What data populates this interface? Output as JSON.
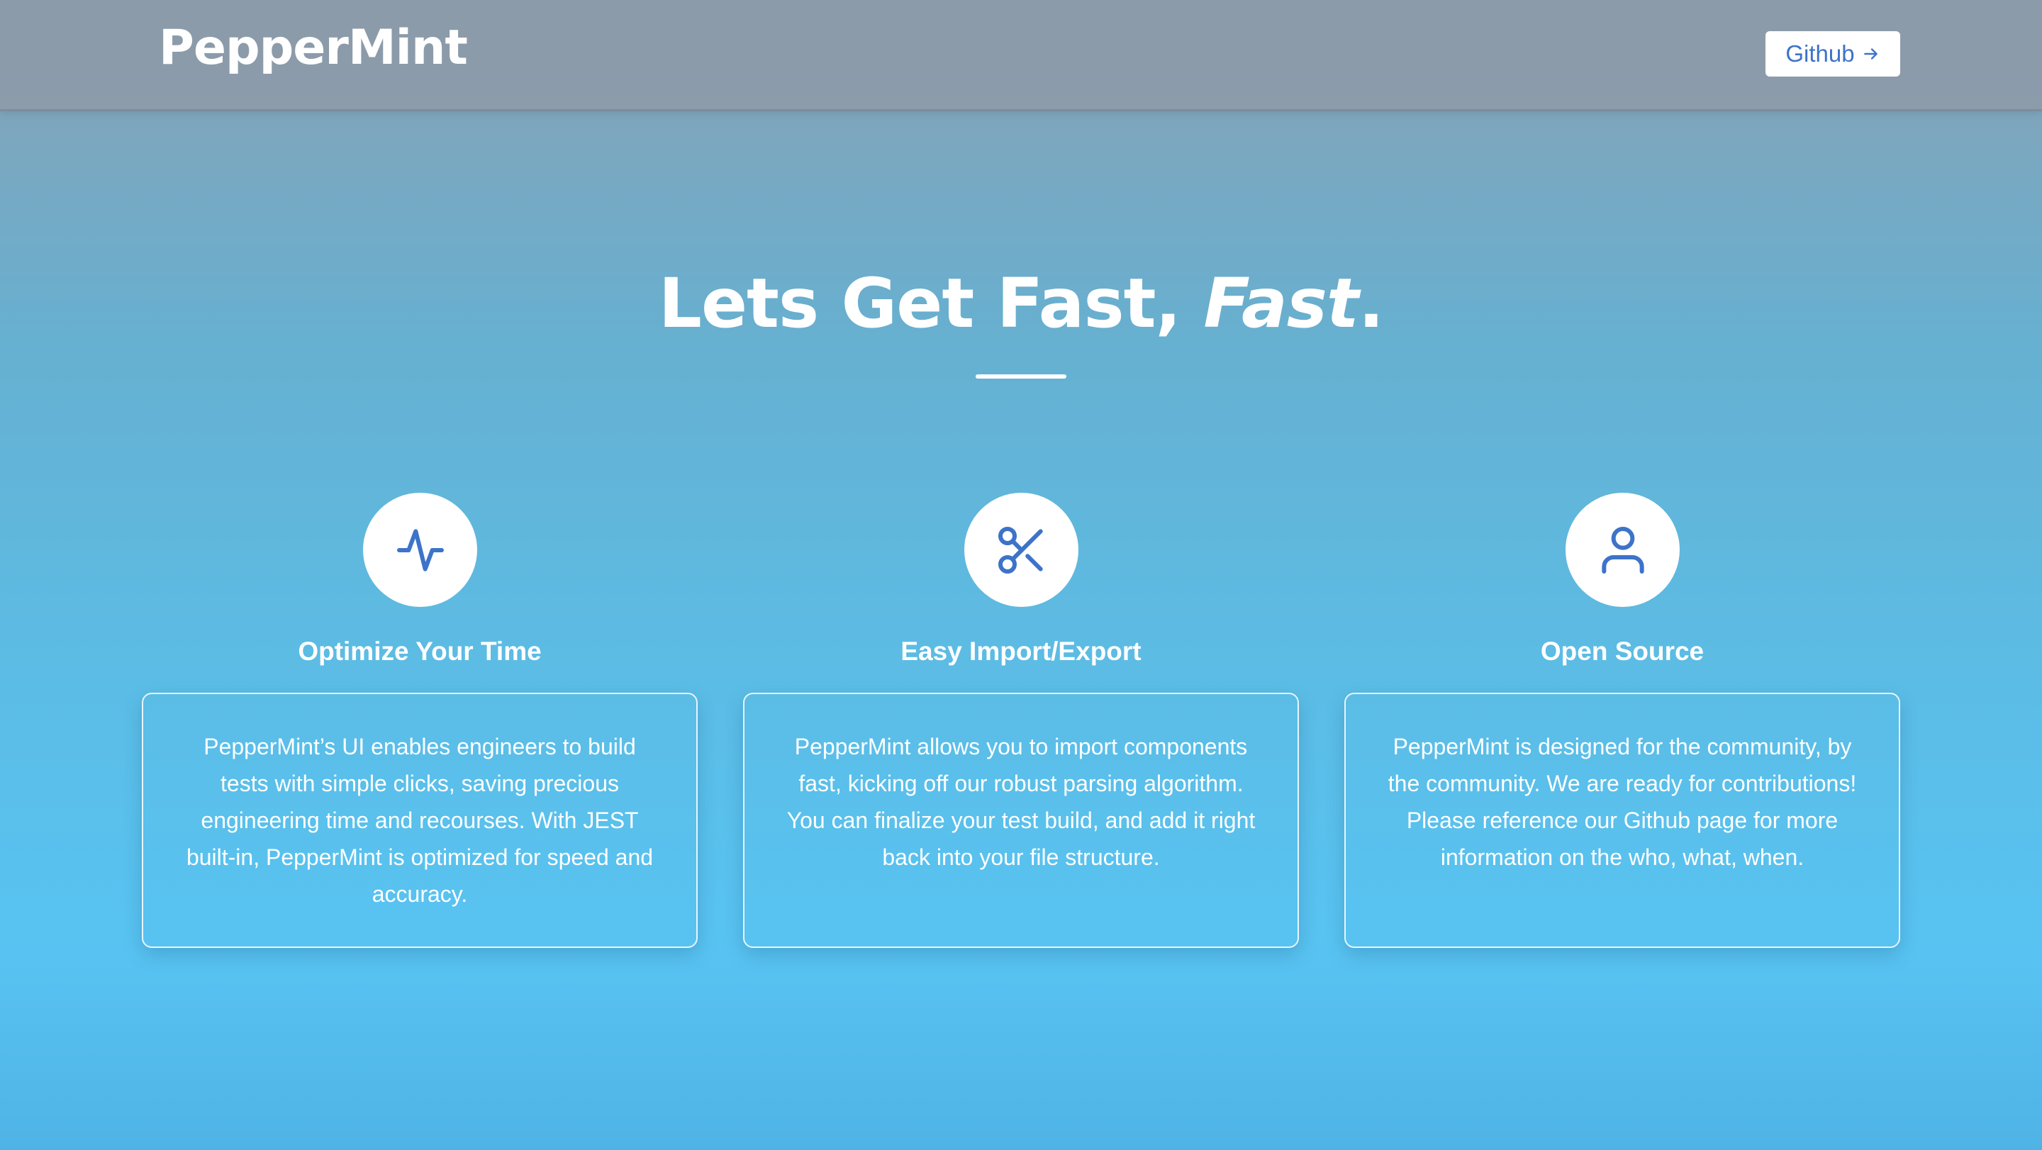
{
  "navbar": {
    "logo": "PepperMint",
    "github_label": "Github",
    "github_icon": "arrow-right-icon"
  },
  "hero": {
    "title_main": "Lets Get Fast, ",
    "title_emphasis": "Fast",
    "title_end": "."
  },
  "features": [
    {
      "icon": "activity-pulse-icon",
      "title": "Optimize Your Time",
      "description": "PepperMint’s UI enables engineers to build tests with simple clicks, saving precious engineering time and recourses. With JEST built-in, PepperMint is optimized for speed and accuracy."
    },
    {
      "icon": "scissors-icon",
      "title": "Easy Import/Export",
      "description": "PepperMint allows you to import components fast, kicking off our robust parsing algorithm. You can finalize your test build, and add it right back into your file structure."
    },
    {
      "icon": "user-icon",
      "title": "Open Source",
      "description": "PepperMint is designed for the community, by the community. We are ready for contributions! Please reference our Github page for more information on the who, what, when."
    }
  ],
  "colors": {
    "accent": "#3d73c9",
    "text": "#ffffff",
    "nav_bg": "#8b9cab",
    "page_bg_bottom": "#58c3f2"
  }
}
